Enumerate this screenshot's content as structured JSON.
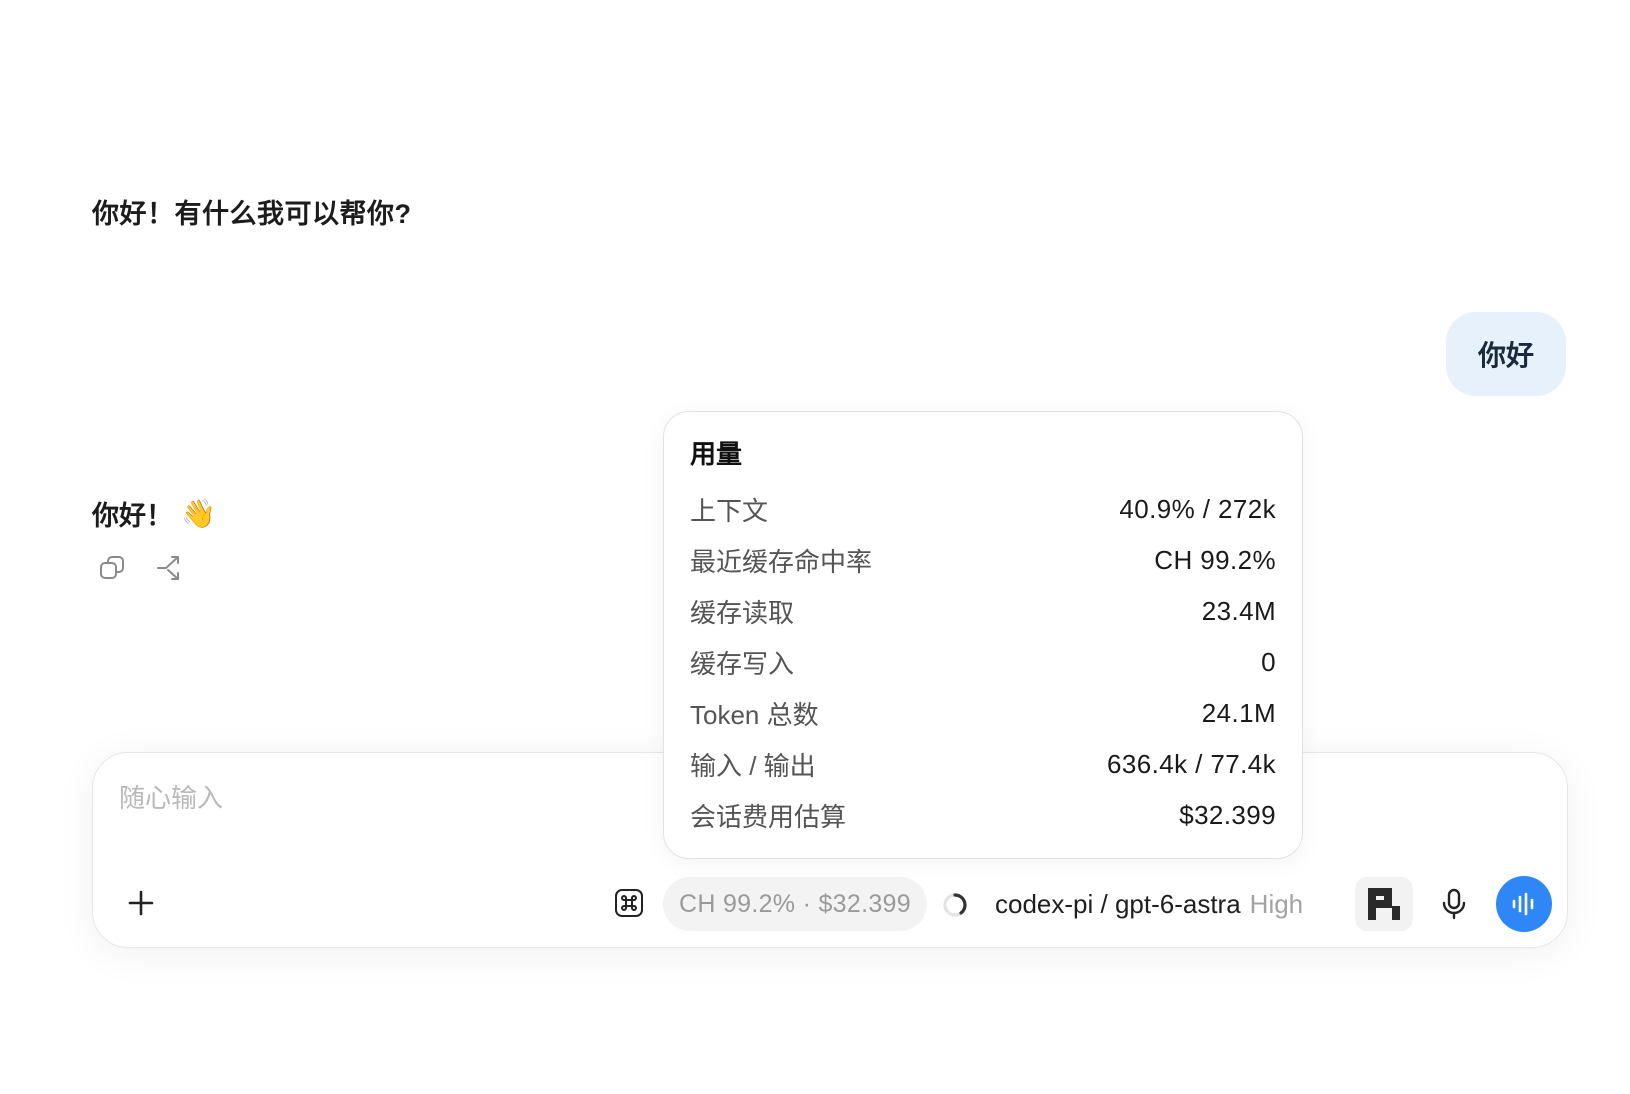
{
  "conversation": {
    "assistant_first": "你好！有什么我可以帮你?",
    "user_message": "你好",
    "assistant_second": "你好！",
    "assistant_second_emoji": "👋"
  },
  "actions": {
    "copy_icon": "copy-icon",
    "fork_icon": "fork-icon"
  },
  "usage_popover": {
    "title": "用量",
    "rows": [
      {
        "label": "上下文",
        "value": "40.9% / 272k"
      },
      {
        "label": "最近缓存命中率",
        "value": "CH 99.2%"
      },
      {
        "label": "缓存读取",
        "value": "23.4M"
      },
      {
        "label": "缓存写入",
        "value": "0"
      },
      {
        "label": "Token 总数",
        "value": "24.1M"
      },
      {
        "label": "输入 / 输出",
        "value": "636.4k / 77.4k"
      },
      {
        "label": "会话费用估算",
        "value": "$32.399"
      }
    ]
  },
  "composer": {
    "placeholder": "随心输入",
    "usage_chip": "CH 99.2% · $32.399",
    "model_name": "codex-pi / gpt-6-astra",
    "model_effort": "High"
  },
  "colors": {
    "user_bubble": "#e7f1fb",
    "voice_button": "#2f86f6",
    "chip_bg": "#f3f3f3"
  }
}
